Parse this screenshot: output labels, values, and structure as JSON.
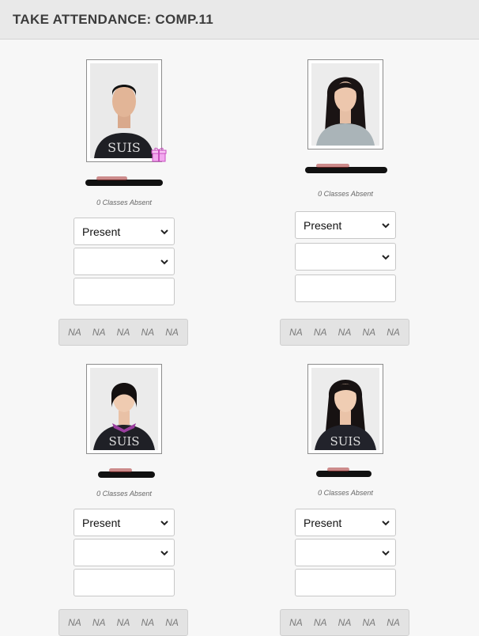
{
  "header": {
    "title": "TAKE ATTENDANCE: COMP.11"
  },
  "students": [
    {
      "absent_text": "0 Classes Absent",
      "status": "Present",
      "history": [
        "NA",
        "NA",
        "NA",
        "NA",
        "NA"
      ],
      "has_gift": true
    },
    {
      "absent_text": "0 Classes Absent",
      "status": "Present",
      "history": [
        "NA",
        "NA",
        "NA",
        "NA",
        "NA"
      ],
      "has_gift": false
    },
    {
      "absent_text": "0 Classes Absent",
      "status": "Present",
      "history": [
        "NA",
        "NA",
        "NA",
        "NA",
        "NA"
      ],
      "has_gift": false
    },
    {
      "absent_text": "0 Classes Absent",
      "status": "Present",
      "history": [
        "NA",
        "NA",
        "NA",
        "NA",
        "NA"
      ],
      "has_gift": false
    }
  ],
  "icons": {
    "gift": "gift-icon",
    "chevron": "chevron-down-icon"
  },
  "colors": {
    "header_bg": "#e9e9e9",
    "page_bg": "#f7f7f7",
    "gift": "#e070d8"
  }
}
